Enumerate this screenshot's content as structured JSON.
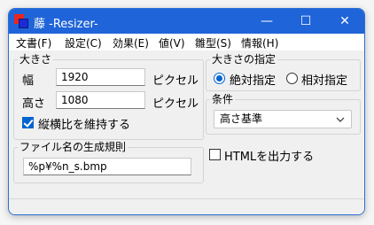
{
  "window": {
    "title": "藤 -Resizer-",
    "minimize": "—",
    "maximize": "☐",
    "close": "✕"
  },
  "menu": [
    "文書(F)",
    "設定(C)",
    "効果(E)",
    "値(V)",
    "雛型(S)",
    "情報(H)"
  ],
  "size_group": {
    "legend": "大きさ",
    "width_label": "幅",
    "width_value": "1920",
    "width_unit": "ピクセル",
    "height_label": "高さ",
    "height_value": "1080",
    "height_unit": "ピクセル",
    "keep_ratio_label": "縦横比を維持する",
    "keep_ratio_checked": true
  },
  "spec_group": {
    "legend": "大きさの指定",
    "absolute_label": "絶対指定",
    "absolute_selected": true,
    "relative_label": "相対指定"
  },
  "condition_group": {
    "legend": "条件",
    "selected": "高さ基準"
  },
  "html_output": {
    "label": "HTMLを出力する",
    "checked": false
  },
  "filename_group": {
    "legend": "ファイル名の生成規則",
    "value": "%p¥%n_s.bmp"
  },
  "colors": {
    "titlebar": "#1f64d8",
    "accent": "#0063d0"
  }
}
